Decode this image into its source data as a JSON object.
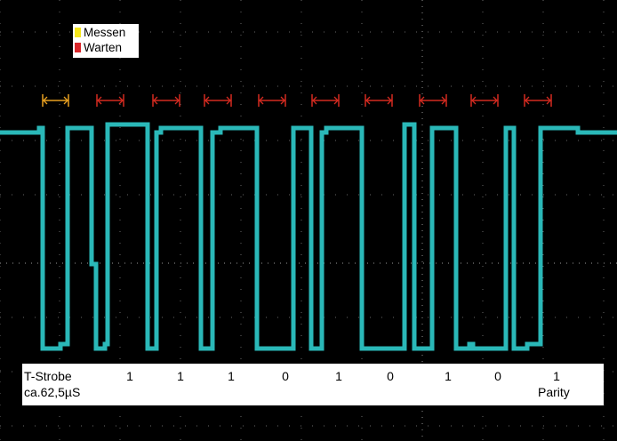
{
  "legend": {
    "items": [
      {
        "label": "Messen",
        "color": "#f5e61a"
      },
      {
        "label": "Warten",
        "color": "#d9262a"
      }
    ]
  },
  "signal": {
    "color": "#2ab8b8",
    "bits": [
      "1",
      "1",
      "1",
      "0",
      "1",
      "0",
      "1",
      "0",
      "1"
    ]
  },
  "info": {
    "strobe_label": "T-Strobe",
    "duration_label": "ca.62,5µS",
    "parity_label": "Parity"
  },
  "markers": {
    "measure_color": "#e8a020",
    "wait_color": "#d42a20"
  }
}
